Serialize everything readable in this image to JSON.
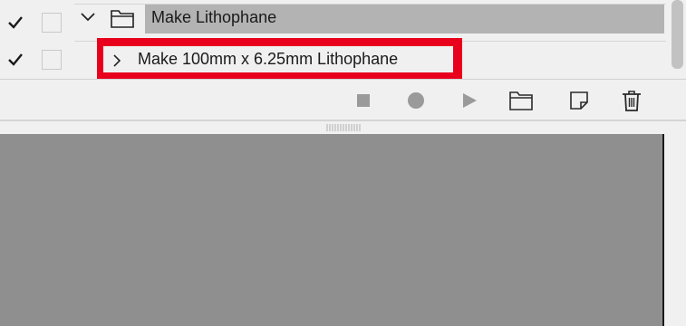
{
  "actions_panel": {
    "action_set": {
      "label": "Make Lithophane",
      "enabled": true,
      "expanded": true
    },
    "action": {
      "label": "Make 100mm x 6.25mm Lithophane",
      "enabled": true,
      "expanded": false
    }
  },
  "toolbar": {
    "buttons": [
      "stop-icon",
      "record-icon",
      "play-icon",
      "new-set-icon",
      "new-action-icon",
      "delete-icon"
    ]
  },
  "colors": {
    "highlight": "#e8001c",
    "set_bar": "#b3b3b3",
    "panel_bg": "#f0f0f0",
    "canvas_bg": "#8f8f8f"
  }
}
